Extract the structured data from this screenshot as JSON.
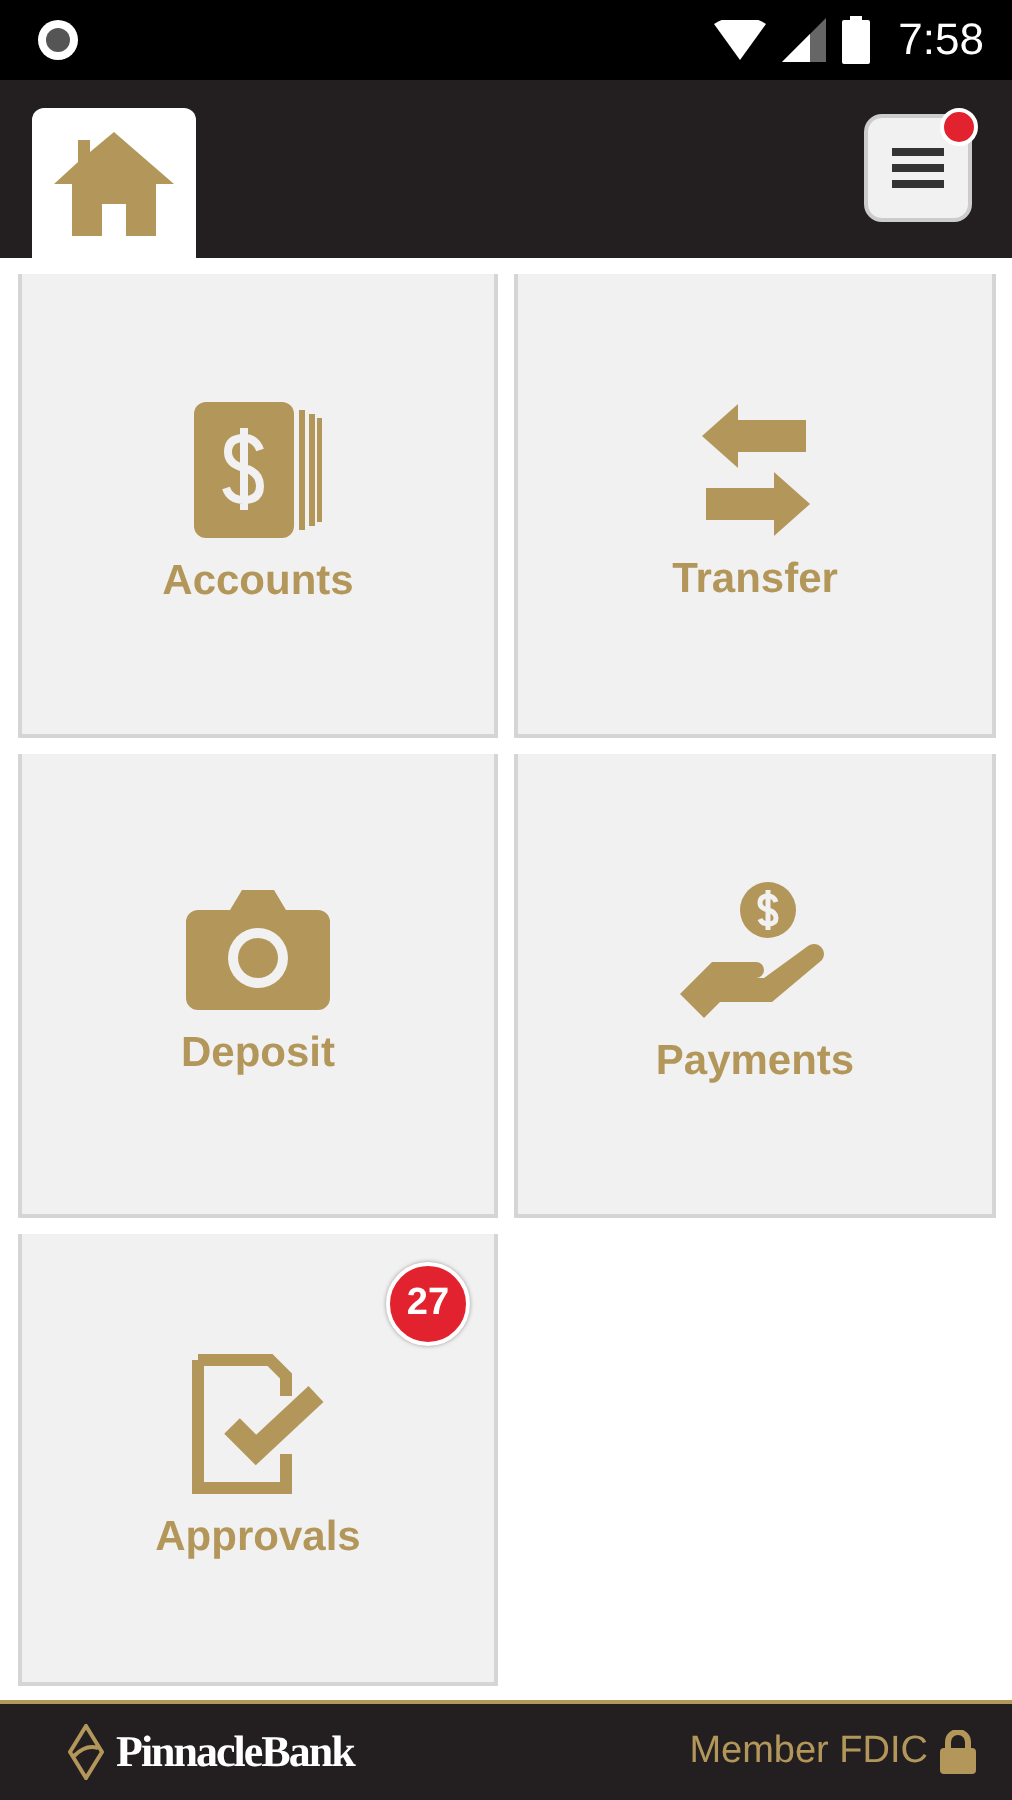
{
  "status_bar": {
    "time": "7:58"
  },
  "app_bar": {
    "home_tab": {
      "selected": true
    },
    "menu": {
      "has_notification": true
    }
  },
  "tiles": [
    {
      "label": "Accounts",
      "kind": "accounts"
    },
    {
      "label": "Transfer",
      "kind": "transfer"
    },
    {
      "label": "Deposit",
      "kind": "deposit"
    },
    {
      "label": "Payments",
      "kind": "payments"
    },
    {
      "label": "Approvals",
      "kind": "approvals",
      "badge": "27"
    }
  ],
  "footer": {
    "brand": "PinnacleBank",
    "member": "Member FDIC"
  }
}
